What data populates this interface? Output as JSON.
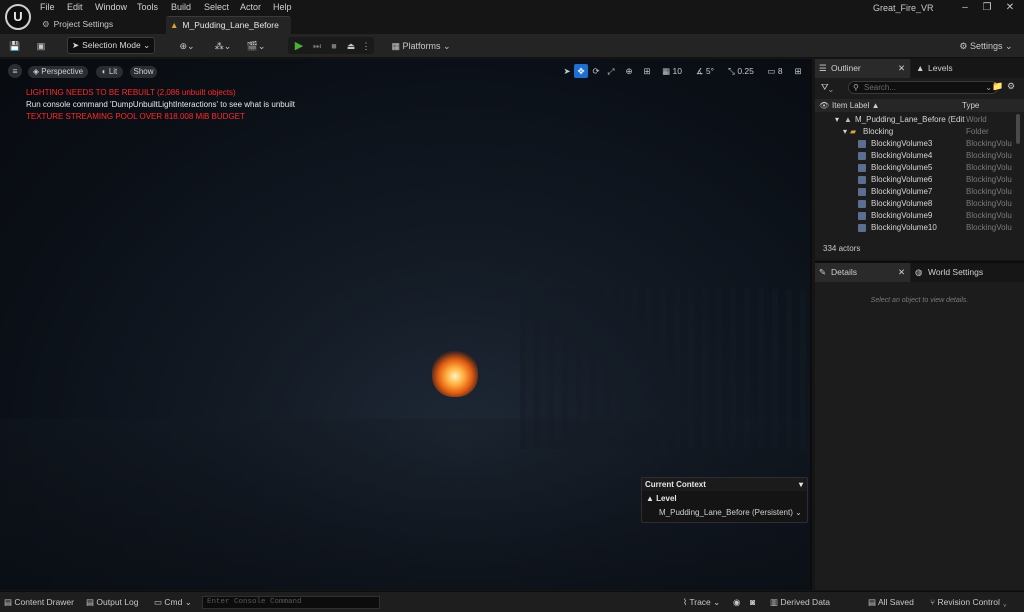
{
  "menu": [
    "File",
    "Edit",
    "Window",
    "Tools",
    "Build",
    "Select",
    "Actor",
    "Help"
  ],
  "project_title": "Great_Fire_VR",
  "tabs": {
    "project_settings": "Project Settings",
    "level": "M_Pudding_Lane_Before"
  },
  "toolbar": {
    "selection_mode": "Selection Mode",
    "platforms": "Platforms",
    "settings": "Settings"
  },
  "viewport": {
    "perspective": "Perspective",
    "lit": "Lit",
    "show": "Show",
    "grid_snap": "10",
    "rot_snap": "5°",
    "scale_snap": "0.25",
    "camera_speed": "8",
    "warnings": [
      {
        "text": "LIGHTING NEEDS TO BE REBUILT (2,086 unbuilt objects)",
        "color": "#ff2a2a"
      },
      {
        "text": "Run console command 'DumpUnbuiltLightInteractions' to see what is unbuilt",
        "color": "#e8e8e8"
      },
      {
        "text": "TEXTURE STREAMING POOL OVER 818.008 MiB BUDGET",
        "color": "#ff2a2a"
      }
    ]
  },
  "context": {
    "title": "Current Context",
    "label": "Level",
    "value": "M_Pudding_Lane_Before (Persistent)"
  },
  "outliner": {
    "tab": "Outliner",
    "levels_tab": "Levels",
    "search_placeholder": "Search...",
    "col_label": "Item Label ▲",
    "col_type": "Type",
    "rows": [
      {
        "name": "M_Pudding_Lane_Before (Edit",
        "type": "World"
      },
      {
        "name": "Blocking",
        "type": "Folder"
      },
      {
        "name": "BlockingVolume3",
        "type": "BlockingVolu"
      },
      {
        "name": "BlockingVolume4",
        "type": "BlockingVolu"
      },
      {
        "name": "BlockingVolume5",
        "type": "BlockingVolu"
      },
      {
        "name": "BlockingVolume6",
        "type": "BlockingVolu"
      },
      {
        "name": "BlockingVolume7",
        "type": "BlockingVolu"
      },
      {
        "name": "BlockingVolume8",
        "type": "BlockingVolu"
      },
      {
        "name": "BlockingVolume9",
        "type": "BlockingVolu"
      },
      {
        "name": "BlockingVolume10",
        "type": "BlockingVolu"
      }
    ],
    "actor_count": "334 actors"
  },
  "details": {
    "tab": "Details",
    "world_settings_tab": "World Settings",
    "empty": "Select an object to view details."
  },
  "statusbar": {
    "content_drawer": "Content Drawer",
    "output_log": "Output Log",
    "cmd": "Cmd",
    "console_placeholder": "Enter Console Command",
    "trace": "Trace",
    "derived_data": "Derived Data",
    "all_saved": "All Saved",
    "revision_control": "Revision Control"
  },
  "colors": {
    "accent_blue": "#1f6fd0",
    "play_green": "#4caf3a",
    "panel_bg": "#1c1c1c"
  }
}
